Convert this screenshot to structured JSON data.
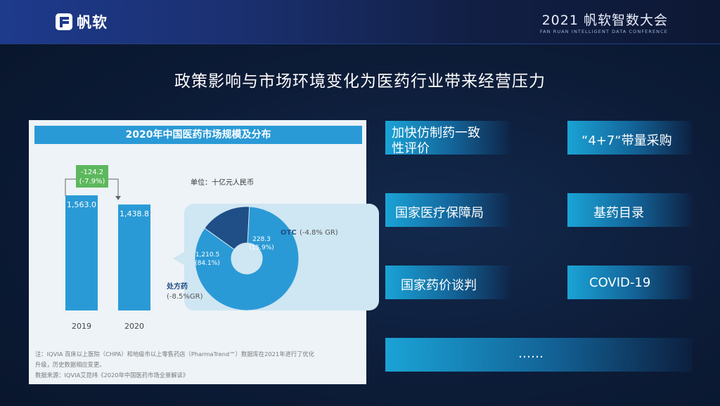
{
  "header": {
    "logo_text": "帆软",
    "conference_title": "2021 帆软智数大会",
    "conference_subtitle": "FAN RUAN INTELLIGENT DATA CONFERENCE"
  },
  "headline": "政策影响与市场环境变化为医药行业带来经营压力",
  "chart_panel": {
    "title": "2020年中国医药市场规模及分布",
    "unit": "单位：十亿元人民币",
    "note_line1": "注：IQVIA 百床以上医院（CHPA）和地级市以上零售药店（PharmaTrend™）数据库在2021年进行了优化",
    "note_line2": "升级，历史数据相应变更。",
    "source": "数据来源：IQVIA艾昆纬《2020年中国医药市场全景解读》",
    "colors": {
      "bar": "#2a9ad6",
      "donut_main": "#2a9ad6",
      "donut_otc": "#1f4f86",
      "change_box": "#5cb85c"
    }
  },
  "chart_data": [
    {
      "type": "bar",
      "categories": [
        "2019",
        "2020"
      ],
      "values": [
        1563.0,
        1438.8
      ],
      "value_labels": [
        "1,563.0",
        "1,438.8"
      ],
      "change_label_line1": "-124.2",
      "change_label_line2": "(-7.9%)",
      "ylim": [
        0,
        1650
      ]
    },
    {
      "type": "pie",
      "donut": true,
      "slices": [
        {
          "name": "处方药",
          "growth": "(-8.5%GR)",
          "value": 1210.5,
          "value_label": "1,210.5",
          "share": "(84.1%)"
        },
        {
          "name": "OTC",
          "growth": "(-4.8% GR)",
          "value": 228.3,
          "value_label": "228.3",
          "share": "(15.9%)"
        }
      ]
    }
  ],
  "tags": [
    {
      "line1": "加快仿制药一致",
      "line2": "性评价"
    },
    {
      "line1": "“4+7“带量采购",
      "line2": ""
    },
    {
      "line1": "国家医疗保障局",
      "line2": ""
    },
    {
      "line1": "基药目录",
      "line2": ""
    },
    {
      "line1": "国家药价谈判",
      "line2": ""
    },
    {
      "line1": "COVID-19",
      "line2": ""
    },
    {
      "line1": "……",
      "line2": ""
    }
  ]
}
